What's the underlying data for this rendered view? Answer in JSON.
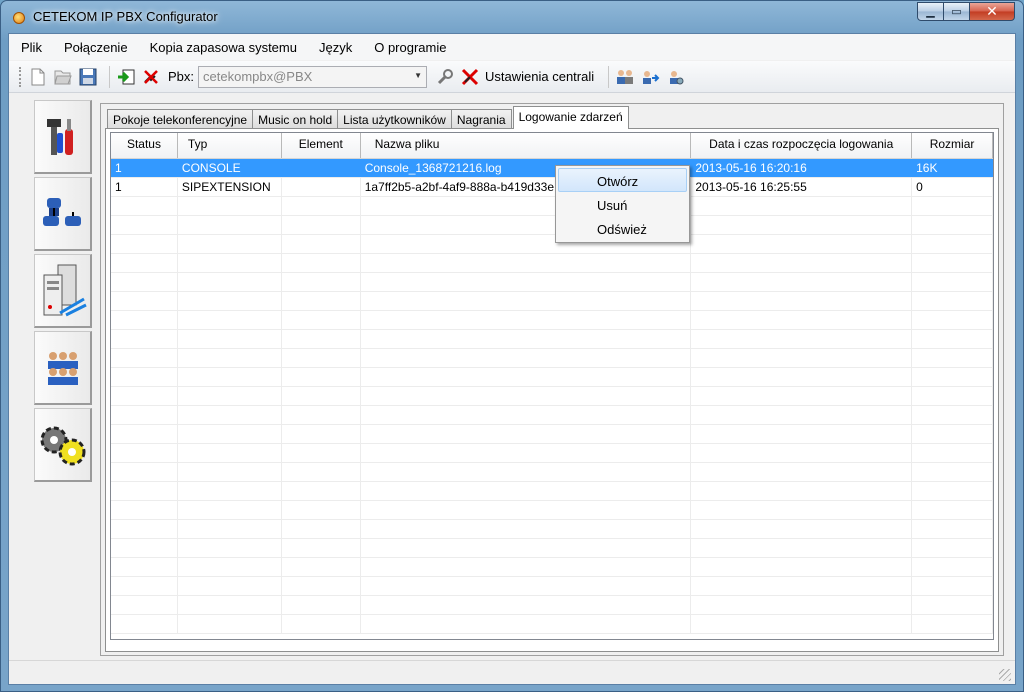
{
  "window": {
    "title": "CETEKOM IP PBX Configurator"
  },
  "menu": [
    "Plik",
    "Połączenie",
    "Kopia zapasowa systemu",
    "Język",
    "O programie"
  ],
  "toolbar": {
    "pbx_label": "Pbx:",
    "pbx_value": "cetekompbx@PBX",
    "settings_label": "Ustawienia centrali",
    "icons": [
      "new-file-icon",
      "open-file-icon",
      "save-icon",
      "connect-icon",
      "disconnect-icon",
      "wrench-icon",
      "tools-cross-icon",
      "users-icon",
      "user-transfer-icon",
      "user-settings-icon"
    ]
  },
  "sidebar": {
    "icons": [
      "tools-icon",
      "phones-icon",
      "servers-icon",
      "users-group-icon",
      "gears-icon"
    ]
  },
  "tabs": [
    "Pokoje telekonferencyjne",
    "Music on hold",
    "Lista użytkowników",
    "Nagrania",
    "Logowanie zdarzeń"
  ],
  "active_tab": "Logowanie zdarzeń",
  "table": {
    "columns": [
      "Status",
      "Typ",
      "Element",
      "Nazwa pliku",
      "Data i czas rozpoczęcia logowania",
      "Rozmiar"
    ],
    "rows": [
      [
        "1",
        "CONSOLE",
        "",
        "Console_1368721216.log",
        "2013-05-16 16:20:16",
        "16K"
      ],
      [
        "1",
        "SIPEXTENSION",
        "",
        "1a7ff2b5-a2bf-4af9-888a-b419d33e",
        "2013-05-16 16:25:55",
        "0"
      ]
    ]
  },
  "context_menu": [
    "Otwórz",
    "Usuń",
    "Odśwież"
  ],
  "colors": {
    "selection": "#3399ff",
    "titlebar": "#8fb7d8"
  }
}
